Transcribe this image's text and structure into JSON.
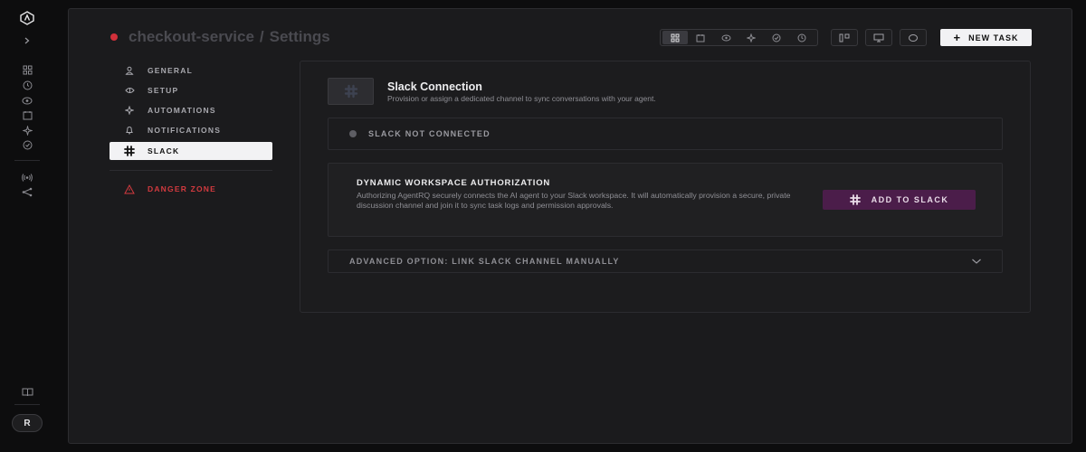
{
  "breadcrumb": {
    "project": "checkout-service",
    "separator": "/",
    "page": "Settings"
  },
  "toolbar": {
    "new_task_label": "NEW TASK"
  },
  "settings_nav": {
    "items": [
      {
        "label": "GENERAL",
        "icon": "user-icon"
      },
      {
        "label": "SETUP",
        "icon": "setup-icon"
      },
      {
        "label": "AUTOMATIONS",
        "icon": "sparkle-icon"
      },
      {
        "label": "NOTIFICATIONS",
        "icon": "bell-icon"
      },
      {
        "label": "SLACK",
        "icon": "slack-icon"
      }
    ],
    "danger_label": "DANGER ZONE"
  },
  "slack": {
    "title": "Slack Connection",
    "description": "Provision or assign a dedicated channel to sync conversations with your agent.",
    "status": "SLACK NOT CONNECTED",
    "auth_title": "DYNAMIC WORKSPACE AUTHORIZATION",
    "auth_description": "Authorizing AgentRQ securely connects the AI agent to your Slack workspace. It will automatically provision a secure, private discussion channel and join it to sync task logs and permission approvals.",
    "add_button": "ADD TO SLACK",
    "advanced_label": "ADVANCED OPTION: LINK SLACK CHANNEL MANUALLY"
  },
  "user": {
    "avatar_initial": "R"
  },
  "colors": {
    "accent_slack": "#4b1d4a",
    "danger": "#d33a3f",
    "status_dot_red": "#d1303a"
  }
}
